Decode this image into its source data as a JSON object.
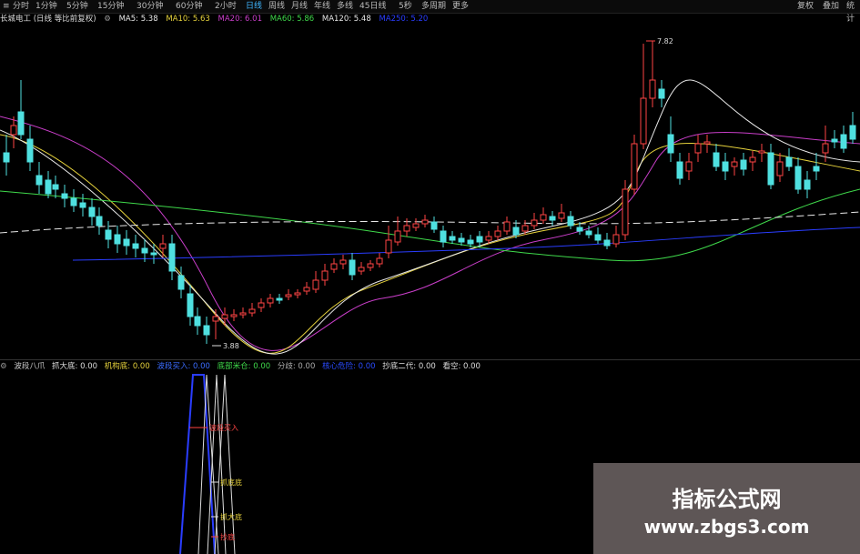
{
  "toolbar": {
    "menu_icon": "menu-icon",
    "timeframes": [
      "分时",
      "1分钟",
      "5分钟",
      "15分钟",
      "30分钟",
      "60分钟",
      "2小时",
      "日线",
      "周线",
      "月线",
      "年线",
      "多线",
      "45日线",
      "5秒",
      "多周期",
      "更多"
    ],
    "active_timeframe": 7,
    "right_buttons": [
      "复权",
      "叠加",
      "统计"
    ]
  },
  "legend": {
    "stock": "长城电工 (日线 等比前复权)",
    "ma5": "MA5: 5.38",
    "ma10": "MA10: 5.63",
    "ma20": "MA20: 6.01",
    "ma60": "MA60: 5.86",
    "ma120": "MA120: 5.48",
    "ma250": "MA250: 5.20"
  },
  "indicator": {
    "name": "波段八爪",
    "items": [
      {
        "label": "抓大底: 0.00",
        "color": "#dddddd"
      },
      {
        "label": "机构底: 0.00",
        "color": "#e6d23c"
      },
      {
        "label": "波段买入: 0.00",
        "color": "#3b6cff"
      },
      {
        "label": "底部米仓: 0.00",
        "color": "#3fd94b"
      },
      {
        "label": "分歧: 0.00",
        "color": "#aaaaaa"
      },
      {
        "label": "核心危险: 0.00",
        "color": "#2a4cff"
      },
      {
        "label": "抄底二代: 0.00",
        "color": "#dddddd"
      },
      {
        "label": "看空: 0.00",
        "color": "#dddddd"
      }
    ],
    "annotations": [
      "波段买入",
      "抓底底",
      "抓大底",
      "抄底"
    ]
  },
  "chart_data": {
    "type": "candlestick",
    "price_high": 7.82,
    "price_low": 3.88,
    "moving_averages": [
      {
        "name": "MA5",
        "value": 5.38,
        "color": "#e8e8e8"
      },
      {
        "name": "MA10",
        "value": 5.63,
        "color": "#e6d23c"
      },
      {
        "name": "MA20",
        "value": 6.01,
        "color": "#c93ec9"
      },
      {
        "name": "MA60",
        "value": 5.86,
        "color": "#3fd94b"
      },
      {
        "name": "MA120",
        "value": 5.48,
        "color": "#e8e8e8"
      },
      {
        "name": "MA250",
        "value": 5.2,
        "color": "#2a3dff"
      }
    ]
  },
  "watermark": {
    "title": "指标公式网",
    "url": "www.zbgs3.com"
  }
}
